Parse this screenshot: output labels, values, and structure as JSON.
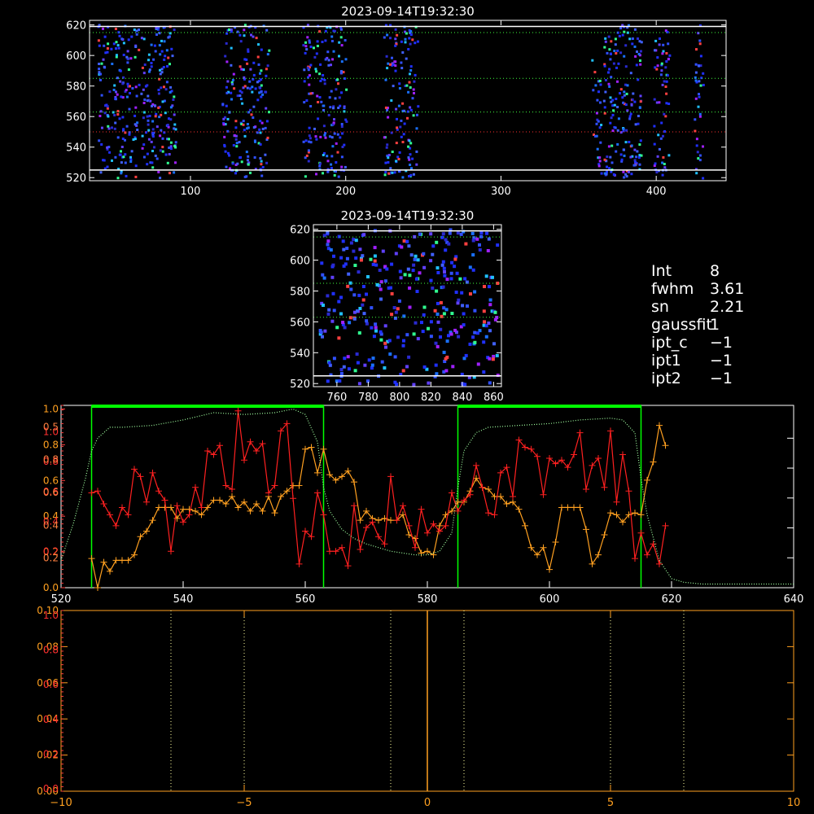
{
  "panel_top": {
    "title": "2023-09-14T19:32:30",
    "xlim": [
      35,
      445
    ],
    "ylim": [
      518,
      623
    ],
    "xticks": [
      100,
      200,
      300,
      400
    ],
    "yticks": [
      520,
      540,
      560,
      580,
      600,
      620
    ],
    "white_hlines": [
      525,
      619
    ],
    "green_hlines": [
      615,
      585,
      563
    ],
    "red_hlines": [
      550
    ],
    "bands": [
      [
        40,
        90
      ],
      [
        120,
        150
      ],
      [
        172,
        200
      ],
      [
        224,
        246
      ],
      [
        358,
        390
      ],
      [
        398,
        408
      ],
      [
        424,
        430
      ]
    ]
  },
  "panel_mid": {
    "title": "2023-09-14T19:32:30",
    "xlim": [
      745,
      865
    ],
    "ylim": [
      518,
      623
    ],
    "xticks": [
      760,
      780,
      800,
      820,
      840,
      860
    ],
    "yticks": [
      520,
      540,
      560,
      580,
      600,
      620
    ],
    "white_hlines": [
      525,
      619
    ],
    "green_hlines": [
      615,
      585,
      563
    ],
    "red_hlines": []
  },
  "info": [
    {
      "key": "Int",
      "value": "8"
    },
    {
      "key": "fwhm",
      "value": "3.61"
    },
    {
      "key": "sn",
      "value": "2.21"
    },
    {
      "key": "gaussfit",
      "value": "1"
    },
    {
      "key": "ipt_c",
      "value": "−1"
    },
    {
      "key": "ipt1",
      "value": "−1"
    },
    {
      "key": "ipt2",
      "value": "−1"
    }
  ],
  "chart_data": [
    {
      "type": "line",
      "id": "profile",
      "xlim": [
        520,
        640
      ],
      "xticks": [
        520,
        540,
        560,
        580,
        600,
        620,
        640
      ],
      "yticks_orange": [
        "0.0",
        "0.2",
        "0.4",
        "0.6",
        "0.8",
        "1.0"
      ],
      "yticks_red": [
        "0.2",
        "0.4",
        "0.6",
        "0.8",
        "1.0"
      ],
      "yticks_red2": [
        "0.0",
        "0.2",
        "0.4",
        "0.6",
        "0.8"
      ],
      "yticks_mixed": [
        "0.2",
        "0.4",
        "0.6",
        "0.8",
        "0.5"
      ],
      "green_boxes": [
        [
          525,
          563
        ],
        [
          585,
          615
        ]
      ],
      "colors": {
        "axis": "#ffffff",
        "red": "#ff2020",
        "orange": "#ffa020",
        "green": "#00ff00",
        "dotted_green": "#a0ffa0"
      },
      "series": [
        {
          "color": "#ffa020",
          "x": [
            525,
            526,
            527,
            528,
            529,
            530,
            531,
            532,
            533,
            534,
            535,
            536,
            537,
            538,
            539,
            540,
            541,
            542,
            543,
            544,
            545,
            546,
            547,
            548,
            549,
            550,
            551,
            552,
            553,
            554,
            555,
            556,
            557,
            558,
            559,
            560,
            561,
            562,
            563,
            564,
            565,
            566,
            567,
            568,
            569,
            570,
            571,
            572,
            573,
            574,
            575,
            576,
            577,
            578,
            579,
            580,
            581,
            582,
            583,
            584,
            585,
            586,
            587,
            588,
            589,
            590,
            591,
            592,
            593,
            594,
            595,
            596,
            597,
            598,
            599,
            600,
            601,
            602,
            603,
            604,
            605,
            606,
            607,
            608,
            609,
            610,
            611,
            612,
            613,
            614,
            615,
            616,
            617,
            618,
            619
          ],
          "y": [
            0.16,
            0.0,
            0.14,
            0.09,
            0.15,
            0.15,
            0.15,
            0.18,
            0.28,
            0.31,
            0.37,
            0.44,
            0.44,
            0.44,
            0.38,
            0.43,
            0.43,
            0.42,
            0.4,
            0.44,
            0.48,
            0.48,
            0.46,
            0.5,
            0.44,
            0.47,
            0.42,
            0.46,
            0.42,
            0.5,
            0.41,
            0.5,
            0.53,
            0.56,
            0.56,
            0.76,
            0.77,
            0.63,
            0.76,
            0.62,
            0.59,
            0.61,
            0.64,
            0.58,
            0.37,
            0.42,
            0.38,
            0.37,
            0.38,
            0.37,
            0.37,
            0.4,
            0.29,
            0.27,
            0.19,
            0.2,
            0.18,
            0.34,
            0.4,
            0.42,
            0.47,
            0.47,
            0.53,
            0.6,
            0.55,
            0.54,
            0.5,
            0.5,
            0.46,
            0.47,
            0.43,
            0.34,
            0.22,
            0.18,
            0.22,
            0.1,
            0.25,
            0.44,
            0.44,
            0.44,
            0.44,
            0.32,
            0.13,
            0.18,
            0.29,
            0.41,
            0.4,
            0.36,
            0.4,
            0.41,
            0.4,
            0.59,
            0.69,
            0.89,
            0.78
          ]
        },
        {
          "color": "#ff2020",
          "x": [
            525,
            526,
            527,
            528,
            529,
            530,
            531,
            532,
            533,
            534,
            535,
            536,
            537,
            538,
            539,
            540,
            541,
            542,
            543,
            544,
            545,
            546,
            547,
            548,
            549,
            550,
            551,
            552,
            553,
            554,
            555,
            556,
            557,
            558,
            559,
            560,
            561,
            562,
            563,
            564,
            565,
            566,
            567,
            568,
            569,
            570,
            571,
            572,
            573,
            574,
            575,
            576,
            577,
            578,
            579,
            580,
            581,
            582,
            583,
            584,
            585,
            586,
            587,
            588,
            589,
            590,
            591,
            592,
            593,
            594,
            595,
            596,
            597,
            598,
            599,
            600,
            601,
            602,
            603,
            604,
            605,
            606,
            607,
            608,
            609,
            610,
            611,
            612,
            613,
            614,
            615,
            616,
            617,
            618,
            619
          ],
          "y": [
            0.52,
            0.53,
            0.46,
            0.4,
            0.34,
            0.44,
            0.4,
            0.65,
            0.61,
            0.47,
            0.63,
            0.53,
            0.48,
            0.2,
            0.45,
            0.36,
            0.4,
            0.55,
            0.44,
            0.75,
            0.73,
            0.78,
            0.56,
            0.54,
            0.97,
            0.7,
            0.8,
            0.75,
            0.79,
            0.52,
            0.56,
            0.86,
            0.9,
            0.49,
            0.13,
            0.31,
            0.28,
            0.52,
            0.4,
            0.2,
            0.2,
            0.22,
            0.12,
            0.45,
            0.21,
            0.33,
            0.36,
            0.28,
            0.24,
            0.61,
            0.37,
            0.45,
            0.34,
            0.22,
            0.43,
            0.3,
            0.35,
            0.31,
            0.34,
            0.52,
            0.42,
            0.48,
            0.51,
            0.67,
            0.55,
            0.41,
            0.4,
            0.63,
            0.66,
            0.5,
            0.81,
            0.77,
            0.76,
            0.72,
            0.51,
            0.71,
            0.68,
            0.7,
            0.66,
            0.73,
            0.85,
            0.54,
            0.67,
            0.71,
            0.55,
            0.86,
            0.47,
            0.73,
            0.53,
            0.16,
            0.3,
            0.18,
            0.24,
            0.13,
            0.34
          ]
        },
        {
          "color": "#a0ffa0",
          "style": "dotted",
          "x": [
            520,
            522,
            524,
            525,
            526,
            528,
            530,
            535,
            540,
            545,
            550,
            555,
            558,
            560,
            562,
            563,
            564,
            566,
            568,
            570,
            572,
            574,
            576,
            578,
            580,
            582,
            584,
            585,
            586,
            588,
            590,
            595,
            600,
            605,
            610,
            612,
            614,
            615,
            616,
            618,
            620,
            622,
            625,
            630,
            635,
            640
          ],
          "y": [
            0.15,
            0.35,
            0.6,
            0.75,
            0.82,
            0.88,
            0.88,
            0.89,
            0.92,
            0.96,
            0.95,
            0.96,
            0.98,
            0.95,
            0.8,
            0.55,
            0.42,
            0.32,
            0.27,
            0.24,
            0.22,
            0.2,
            0.19,
            0.18,
            0.18,
            0.2,
            0.3,
            0.55,
            0.75,
            0.85,
            0.88,
            0.89,
            0.9,
            0.92,
            0.93,
            0.92,
            0.85,
            0.6,
            0.4,
            0.15,
            0.05,
            0.03,
            0.02,
            0.02,
            0.02,
            0.02
          ]
        }
      ]
    },
    {
      "type": "line",
      "id": "bottom",
      "xlim": [
        -10,
        10
      ],
      "xticks": [
        "−10",
        "−5",
        "0",
        "5",
        "10"
      ],
      "yticks_orange": [
        "0.00",
        "0.02",
        "0.04",
        "0.06",
        "0.08",
        "0.10"
      ],
      "yticks_red": [
        "0.0",
        "0.2",
        "0.4",
        "0.6",
        "0.8",
        "1.0"
      ],
      "dotted_verticals_white": [
        -7,
        -5,
        -1,
        1,
        5,
        7
      ],
      "solid_vertical_orange": [
        0
      ]
    }
  ]
}
